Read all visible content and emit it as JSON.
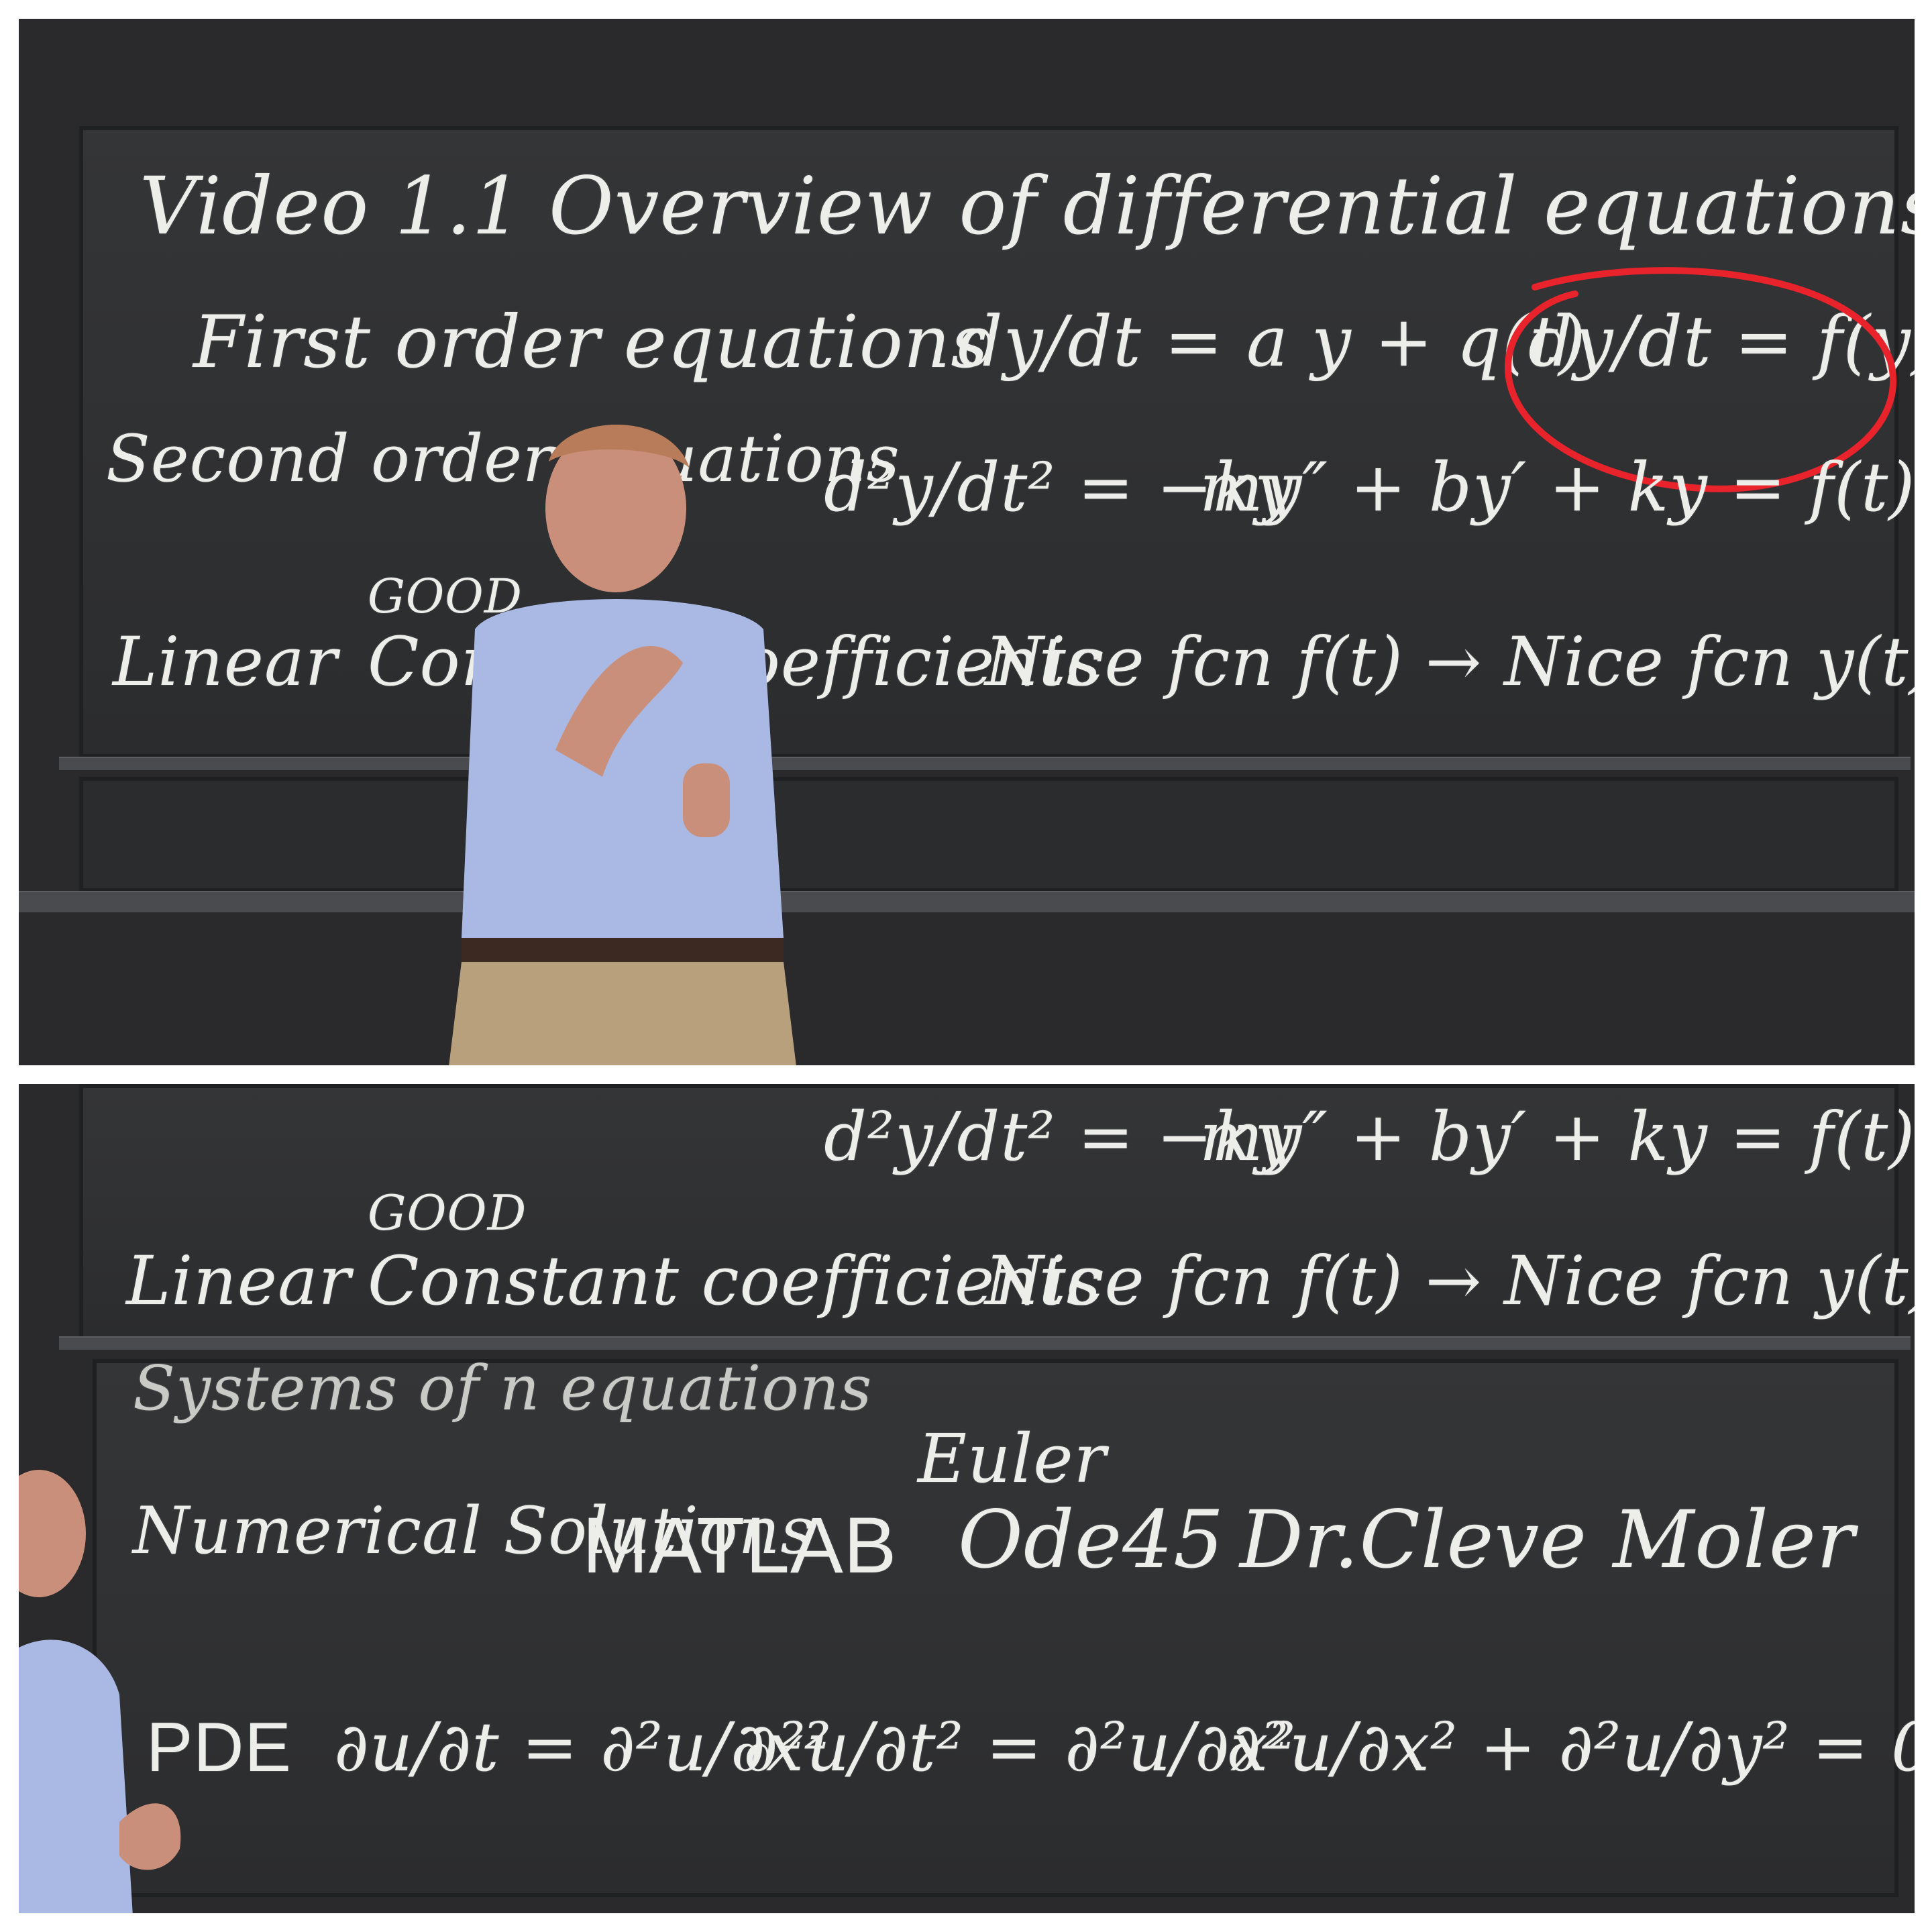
{
  "top_board": {
    "title": "Video 1.1 Overview of differential equations",
    "first_order_label": "First order equations",
    "first_order_eq": "dy/dt = a y + q(t)",
    "circled_eq": "dy/dt = f(y)",
    "second_order_label": "Second order equations",
    "second_order_eq1": "d²y/dt² = −ky",
    "second_order_eq2": "my″ + by′ + ky = f(t)",
    "good_label": "GOOD",
    "linear_label": "Linear",
    "constant_label": "Constant coefficients",
    "nice_fn": "Nice fcn f(t) → Nice fcn y(t)"
  },
  "bottom_board": {
    "second_order_eq1": "d²y/dt² = −ky",
    "second_order_eq2": "my″ + by′ + ky = f(t)",
    "good_label": "GOOD",
    "linear_label": "Linear",
    "constant_label": "Constant coefficients",
    "nice_fn": "Nice fcn f(t) → Nice fcn y(t)",
    "systems_label": "Systems of n equations",
    "euler_label": "Euler",
    "numerical_label": "Numerical Solutions",
    "matlab_label": "MATLAB",
    "ode_label": "Ode45",
    "moler_label": "Dr.Cleve Moler",
    "pde_label": "PDE",
    "pde_eq1": "∂u/∂t = ∂²u/∂x²",
    "pde_eq2": "∂²u/∂t² = ∂²u/∂x²",
    "pde_eq3": "∂²u/∂x² + ∂²u/∂y² = 0"
  },
  "colors": {
    "chalk": "#ededea",
    "board": "#313234",
    "annotation_red": "#e8232b"
  }
}
